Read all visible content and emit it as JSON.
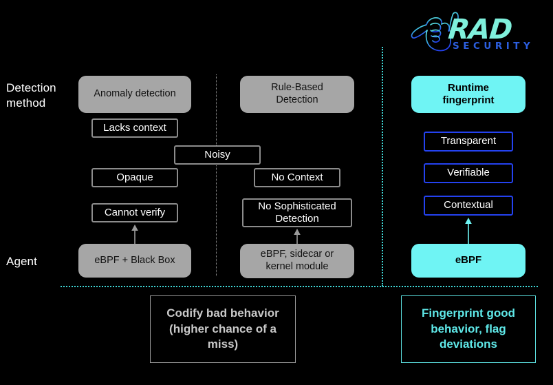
{
  "brand": {
    "logo_icon": "shaka-hand-icon",
    "name": "RAD",
    "tagline": "SECURITY",
    "colors": {
      "cyan": "#6ff4f4",
      "mint": "#7ff0dc",
      "blue": "#2442f0",
      "gray": "#a6a6a6"
    }
  },
  "rows": {
    "detection_method": "Detection\nmethod",
    "agent": "Agent"
  },
  "columns": [
    {
      "id": "anomaly",
      "head": "Anomaly detection",
      "chips": [
        "Lacks context",
        "Opaque",
        "Cannot verify"
      ],
      "agent": "eBPF + Black Box",
      "summary": "Codify bad behavior\n(higher chance of a\nmiss)"
    },
    {
      "id": "rule-based",
      "head": "Rule-Based\nDetection",
      "chips": [
        "Noisy",
        "No Context",
        "No Sophisticated\nDetection"
      ],
      "agent": "eBPF, sidecar or\nkernel module",
      "summary": ""
    },
    {
      "id": "runtime-fingerprint",
      "head": "Runtime\nfingerprint",
      "chips": [
        "Transparent",
        "Verifiable",
        "Contextual"
      ],
      "agent": "eBPF",
      "summary": "Fingerprint good\nbehavior, flag\ndeviations"
    }
  ]
}
